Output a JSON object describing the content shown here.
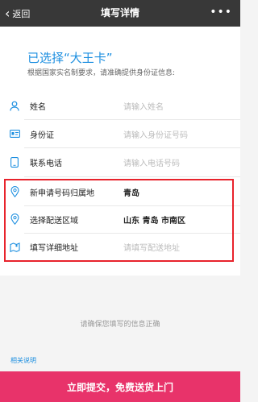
{
  "topbar": {
    "back_label": "返回",
    "title": "填写详情",
    "more": "•••"
  },
  "header": {
    "headline": "已选择“大王卡”",
    "subline": "根据国家实名制要求，请准确提供身份证信息:"
  },
  "form": {
    "name": {
      "label": "姓名",
      "placeholder": "请输入姓名",
      "icon": "person-icon"
    },
    "id_card": {
      "label": "身份证",
      "placeholder": "请输入身份证号码",
      "icon": "id-card-icon"
    },
    "phone": {
      "label": "联系电话",
      "placeholder": "请输入电话号码",
      "icon": "phone-icon"
    },
    "region": {
      "label": "新申请号码归属地",
      "value": "青岛",
      "icon": "location-pin-icon"
    },
    "delivery_area": {
      "label": "选择配送区域",
      "value": "山东 青岛 市南区",
      "icon": "location-pin-icon"
    },
    "address": {
      "label": "填写详细地址",
      "placeholder": "请填写配送地址",
      "icon": "map-icon"
    }
  },
  "notice": "请确保您填写的信息正确",
  "help_link": "相关说明",
  "submit_label": "立即提交，免费送货上门",
  "colors": {
    "accent_blue": "#1d8fe0",
    "submit_pink": "#e8336a",
    "highlight_red": "#e8232c",
    "topbar": "#383838"
  }
}
